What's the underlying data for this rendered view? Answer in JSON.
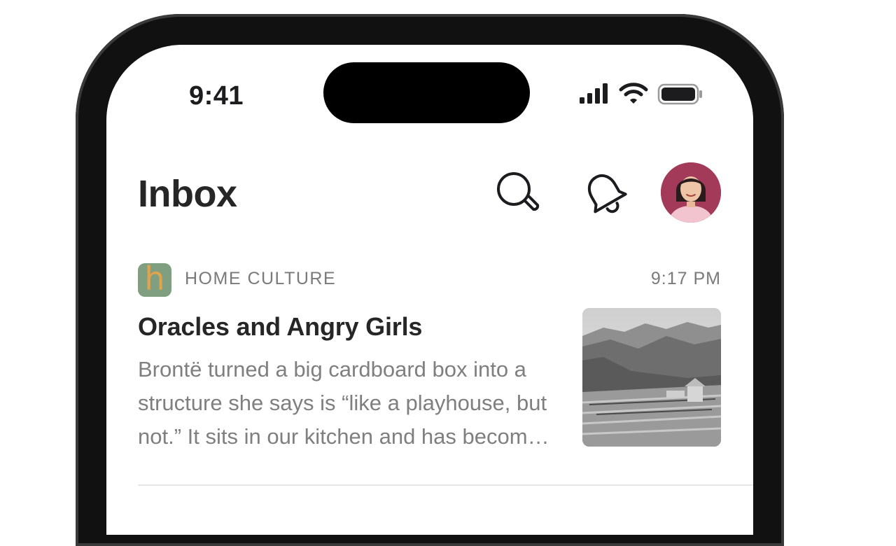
{
  "status_bar": {
    "time": "9:41"
  },
  "header": {
    "title": "Inbox",
    "search_icon": "search-icon",
    "notifications_icon": "bell-icon",
    "avatar_icon": "profile-avatar"
  },
  "inbox": {
    "items": [
      {
        "publication": "HOME CULTURE",
        "logo_letter": "h",
        "logo_bg": "#7f9f80",
        "logo_fg": "#e1a34c",
        "time": "9:17 PM",
        "title": "Oracles and Angry Girls",
        "excerpt": "Brontë turned a big cardboard box into a structure she says is “like a playhouse, but not.” It sits in our kitchen and has become a lot of things to her."
      }
    ]
  },
  "colors": {
    "text_primary": "#262626",
    "text_secondary": "#7a7a7a",
    "avatar_bg": "#a33a59",
    "frame": "#111111"
  }
}
